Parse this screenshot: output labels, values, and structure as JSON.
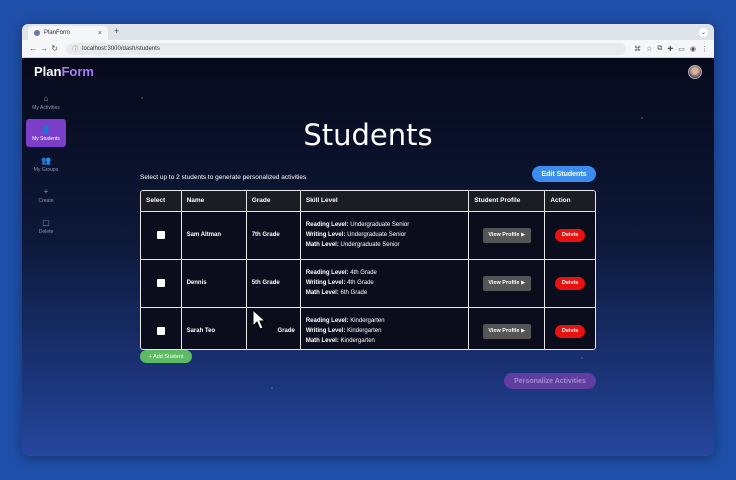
{
  "browser": {
    "tab_title": "PlanForm",
    "tab_close": "×",
    "new_tab": "+",
    "url": "localhost:3000/dash/students",
    "back": "←",
    "forward": "→",
    "reload": "↻",
    "menu": "⌄"
  },
  "app": {
    "logo_main": "Plan",
    "logo_accent": "Form",
    "accent_color": "#7b3ec8"
  },
  "sidebar": {
    "items": [
      {
        "label": "My Activities",
        "icon": "⌂"
      },
      {
        "label": "My Students",
        "icon": "👤"
      },
      {
        "label": "My Groups",
        "icon": "👥"
      },
      {
        "label": "Create",
        "icon": "+"
      },
      {
        "label": "Delete",
        "icon": "▢"
      }
    ]
  },
  "page": {
    "title": "Students",
    "instructions": "Select up to 2 students to generate personalized activities",
    "edit_button": "Edit Students",
    "add_button": "+ Add Student",
    "personalize_button": "Personalize Activities"
  },
  "table": {
    "headers": [
      "Select",
      "Name",
      "Grade",
      "Skill Level",
      "Student Profile",
      "Action"
    ],
    "reading_label": "Reading Level:",
    "writing_label": "Writing Level:",
    "math_label": "Math Level:",
    "profile_button": "View Profile ▶",
    "delete_button": "Delete",
    "rows": [
      {
        "name": "Sam Altman",
        "grade": "7th Grade",
        "reading": "Undergraduate Senior",
        "writing": "Undergraduate Senior",
        "math": "Undergraduate Senior"
      },
      {
        "name": "Dennis",
        "grade": "5th Grade",
        "reading": "4th Grade",
        "writing": "4th Grade",
        "math": "6th Grade"
      },
      {
        "name": "Sarah Teo",
        "grade": "Grade",
        "reading": "Kindergarten",
        "writing": "Kindergarten",
        "math": "Kindergarten"
      }
    ]
  }
}
